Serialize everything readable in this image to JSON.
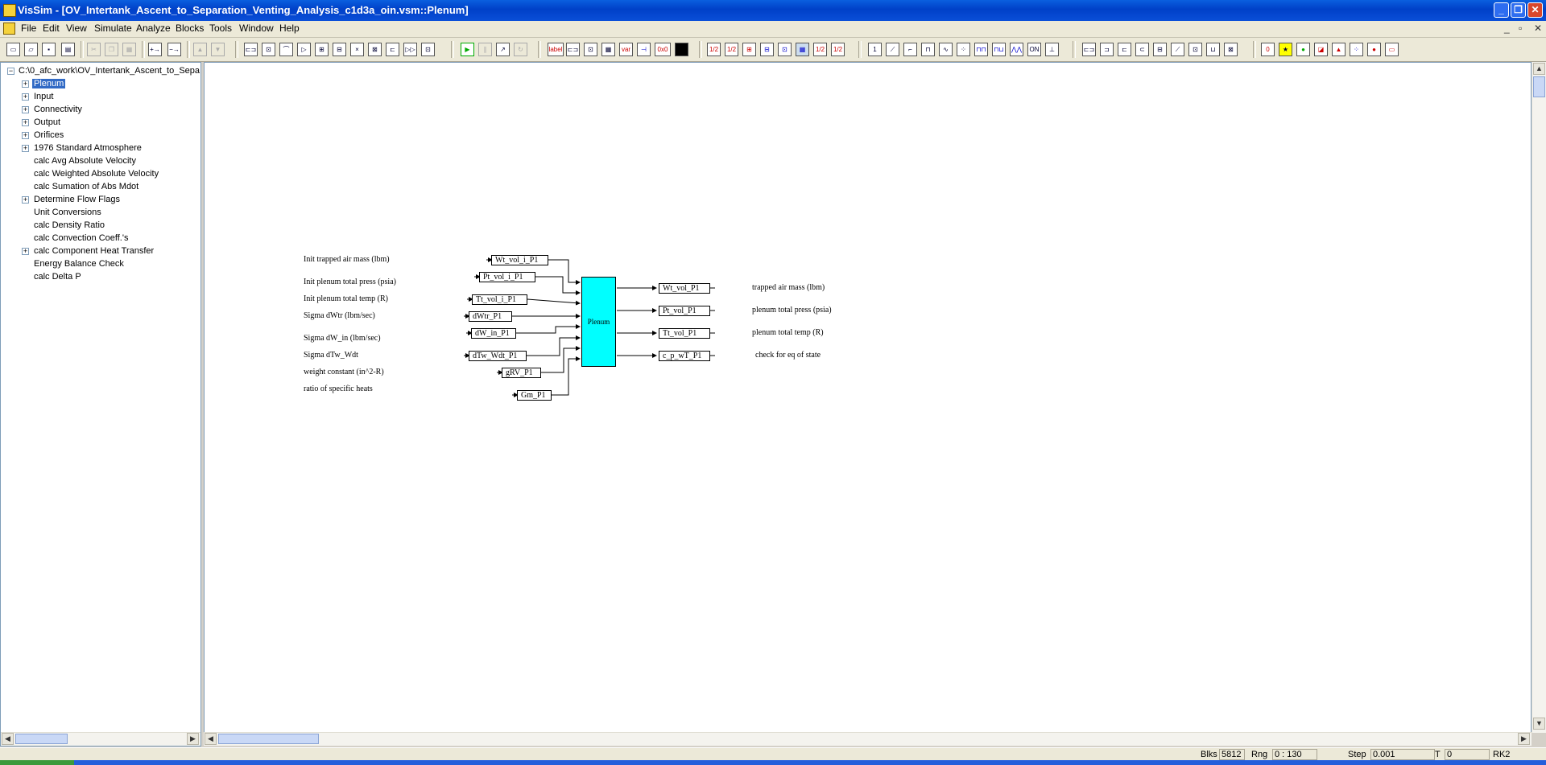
{
  "app": {
    "title": "VisSim - [OV_Intertank_Ascent_to_Separation_Venting_Analysis_c1d3a_oin.vsm::Plenum]",
    "icon": "vissim-app-icon"
  },
  "window_buttons": {
    "minimize": "_",
    "restore": "❐",
    "close": "✕"
  },
  "mdi_buttons": {
    "minimize": "_",
    "restore": "▫",
    "close": "✕"
  },
  "menu": [
    "File",
    "Edit",
    "View",
    "Simulate",
    "Analyze",
    "Blocks",
    "Tools",
    "Window",
    "Help"
  ],
  "toolbar": {
    "label_button": "label",
    "error_button": "0x0",
    "visibility": "1/2",
    "on_button": "ON"
  },
  "tree": {
    "root": "C:\\0_afc_work\\OV_Intertank_Ascent_to_Sepa",
    "items": [
      {
        "label": "Plenum",
        "expandable": true,
        "selected": true
      },
      {
        "label": "Input",
        "expandable": true
      },
      {
        "label": "Connectivity",
        "expandable": true
      },
      {
        "label": "Output",
        "expandable": true
      },
      {
        "label": "Orifices",
        "expandable": true
      },
      {
        "label": "1976 Standard Atmosphere",
        "expandable": true
      },
      {
        "label": "calc Avg Absolute Velocity",
        "expandable": false
      },
      {
        "label": "calc Weighted Absolute Velocity",
        "expandable": false
      },
      {
        "label": "calc Sumation of Abs Mdot",
        "expandable": false
      },
      {
        "label": "Determine Flow Flags",
        "expandable": true
      },
      {
        "label": "Unit Conversions",
        "expandable": false
      },
      {
        "label": "calc Density Ratio",
        "expandable": false
      },
      {
        "label": "calc Convection Coeff.'s",
        "expandable": false
      },
      {
        "label": "calc Component Heat Transfer",
        "expandable": true
      },
      {
        "label": "Energy Balance Check",
        "expandable": false
      },
      {
        "label": "calc Delta P",
        "expandable": false
      }
    ]
  },
  "diagram": {
    "block_label": "Plenum",
    "block_color": "#00ffff",
    "input_labels": [
      "Init trapped air mass (lbm)",
      "Init plenum total press (psia)",
      "Init plenum total temp (R)",
      "Sigma dWtr (lbm/sec)",
      "Sigma dW_in (lbm/sec)",
      "Sigma dTw_Wdt",
      "weight constant (in^2-R)",
      "ratio of specific heats"
    ],
    "input_vars": [
      "Wt_vol_i_P1",
      "Pt_vol_i_P1",
      "Tt_vol_i_P1",
      "dWtr_P1",
      "dW_in_P1",
      "dTw_Wdt_P1",
      "gRV_P1",
      "Gm_P1"
    ],
    "output_vars": [
      "Wt_vol_P1",
      "Pt_vol_P1",
      "Tt_vol_P1",
      "c_p_wT_P1"
    ],
    "output_labels": [
      "trapped air mass (lbm)",
      "plenum total press (psia)",
      "plenum total temp (R)",
      "check for eq of state"
    ]
  },
  "status": {
    "blks_label": "Blks",
    "blks_value": "5812",
    "rng_label": "Rng",
    "rng_value": "0 : 130",
    "step_label": "Step",
    "step_value": "0.001",
    "t_label": "T",
    "t_value": "0",
    "method": "RK2"
  }
}
